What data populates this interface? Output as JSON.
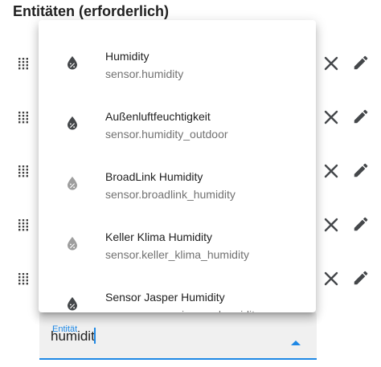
{
  "section": {
    "title": "Entitäten (erforderlich)"
  },
  "entity_rows": [
    {
      "drag_icon": "drag-handle-icon",
      "clear_icon": "close-icon",
      "edit_icon": "pencil-icon"
    },
    {
      "drag_icon": "drag-handle-icon",
      "clear_icon": "close-icon",
      "edit_icon": "pencil-icon"
    },
    {
      "drag_icon": "drag-handle-icon",
      "clear_icon": "close-icon",
      "edit_icon": "pencil-icon"
    },
    {
      "drag_icon": "drag-handle-icon",
      "clear_icon": "close-icon",
      "edit_icon": "pencil-icon"
    },
    {
      "drag_icon": "drag-handle-icon",
      "clear_icon": "close-icon",
      "edit_icon": "pencil-icon"
    }
  ],
  "picker": {
    "label": "Entität",
    "value": "humidit",
    "arrow_icon": "arrow-up-icon"
  },
  "dropdown": {
    "options": [
      {
        "name": "Humidity",
        "entity_id": "sensor.humidity",
        "icon": "water-percent-icon",
        "icon_color": "#44474a"
      },
      {
        "name": "Außenluftfeuchtigkeit",
        "entity_id": "sensor.humidity_outdoor",
        "icon": "water-percent-icon",
        "icon_color": "#44474a"
      },
      {
        "name": "BroadLink Humidity",
        "entity_id": "sensor.broadlink_humidity",
        "icon": "water-percent-icon",
        "icon_color": "#9e9e9e"
      },
      {
        "name": "Keller Klima Humidity",
        "entity_id": "sensor.keller_klima_humidity",
        "icon": "water-percent-icon",
        "icon_color": "#9e9e9e"
      },
      {
        "name": "Sensor Jasper Humidity",
        "entity_id": "sensor.sensor_jasper_humidity",
        "icon": "water-percent-icon",
        "icon_color": "#44474a"
      }
    ]
  },
  "colors": {
    "accent": "#1e88e5",
    "icon_dark": "#44474a",
    "text_secondary": "#727272",
    "field_background": "#f0f0f0"
  }
}
